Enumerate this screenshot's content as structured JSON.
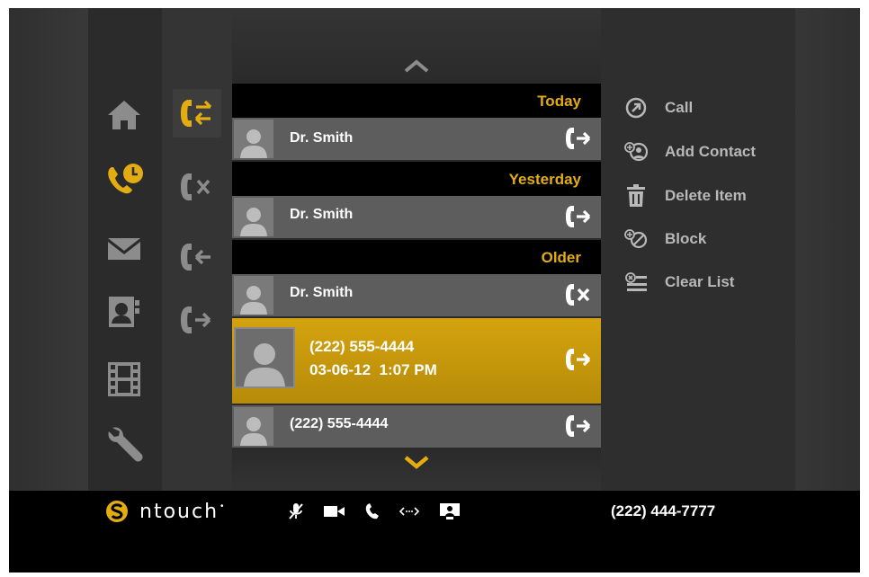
{
  "nav": {
    "items": [
      {
        "icon": "home-icon",
        "active": false
      },
      {
        "icon": "call-history-icon",
        "active": true
      },
      {
        "icon": "mail-icon",
        "active": false
      },
      {
        "icon": "contacts-icon",
        "active": false
      },
      {
        "icon": "video-center-icon",
        "active": false
      },
      {
        "icon": "settings-icon",
        "active": false
      }
    ]
  },
  "filters": {
    "items": [
      {
        "icon": "all-calls-icon",
        "active": true
      },
      {
        "icon": "missed-calls-icon",
        "active": false
      },
      {
        "icon": "incoming-calls-icon",
        "active": false
      },
      {
        "icon": "outgoing-calls-icon",
        "active": false
      }
    ]
  },
  "list": {
    "sections": {
      "today": "Today",
      "yesterday": "Yesterday",
      "older": "Older"
    },
    "rows": [
      {
        "name": "Dr. Smith",
        "direction": "outgoing"
      },
      {
        "name": "Dr. Smith",
        "direction": "outgoing"
      },
      {
        "name": "Dr. Smith",
        "direction": "missed"
      },
      {
        "name": "(222) 555-4444",
        "detail": "03-06-12  1:07 PM",
        "direction": "outgoing",
        "selected": true
      },
      {
        "name": "(222) 555-4444",
        "direction": "outgoing"
      }
    ]
  },
  "actions": {
    "call": "Call",
    "add_contact": "Add Contact",
    "delete_item": "Delete Item",
    "block": "Block",
    "clear_list": "Clear List"
  },
  "bar": {
    "brand": "ntouch",
    "phone": "(222) 444-7777"
  },
  "colors": {
    "accent": "#e3ad12",
    "selected_row": "#c99a0b",
    "row": "#5d5d5d",
    "header": "#000000"
  }
}
